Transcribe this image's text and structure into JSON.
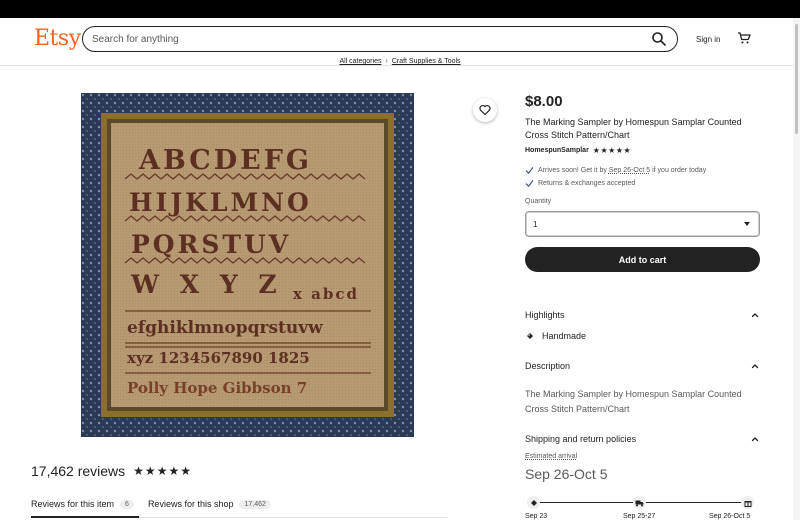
{
  "header": {
    "logo": "Etsy",
    "search_placeholder": "Search for anything",
    "signin": "Sign in"
  },
  "breadcrumb": {
    "items": [
      "All categories",
      "Craft Supplies & Tools"
    ]
  },
  "product": {
    "price": "$8.00",
    "title": "The Marking Sampler by Homespun Samplar Counted Cross Stitch Pattern/Chart",
    "shop_name": "HomespunSamplar",
    "shop_stars": "★★★★★",
    "arrival_prefix": "Arrives soon! Get it by",
    "arrival_dates": "Sep 26-Oct 5",
    "arrival_suffix": "if you order today",
    "returns": "Returns & exchanges accepted",
    "quantity_label": "Quantity",
    "quantity_value": "1",
    "add_to_cart": "Add to cart",
    "image_icon": "cross-stitch-sampler-image"
  },
  "sampler_image": {
    "rows": [
      "ABCDEFG",
      "HIJKLMNO",
      "PQRSTUV",
      "W X Y Z",
      "x abcd",
      "efghiklmnopqrstuvw",
      "xyz 1234567890 1825",
      "Polly Hope Gibbson 7"
    ]
  },
  "highlights": {
    "heading": "Highlights",
    "item": "Handmade"
  },
  "description": {
    "heading": "Description",
    "text": "The Marking Sampler by Homespun Samplar Counted Cross Stitch Pattern/Chart"
  },
  "shipping": {
    "heading": "Shipping and return policies",
    "estimated_label": "Estimated arrival",
    "estimated_dates": "Sep 26-Oct 5",
    "timeline": [
      "Sep 23",
      "Sep 25-27",
      "Sep 26-Oct 5"
    ]
  },
  "reviews": {
    "count": "17,462 reviews",
    "stars": "★★★★★",
    "tab_item": "Reviews for this item",
    "tab_item_count": "6",
    "tab_shop": "Reviews for this shop",
    "tab_shop_count": "17,462"
  },
  "colors": {
    "brand": "#F1641E",
    "button_bg": "#222222",
    "muted_text": "#595959"
  }
}
